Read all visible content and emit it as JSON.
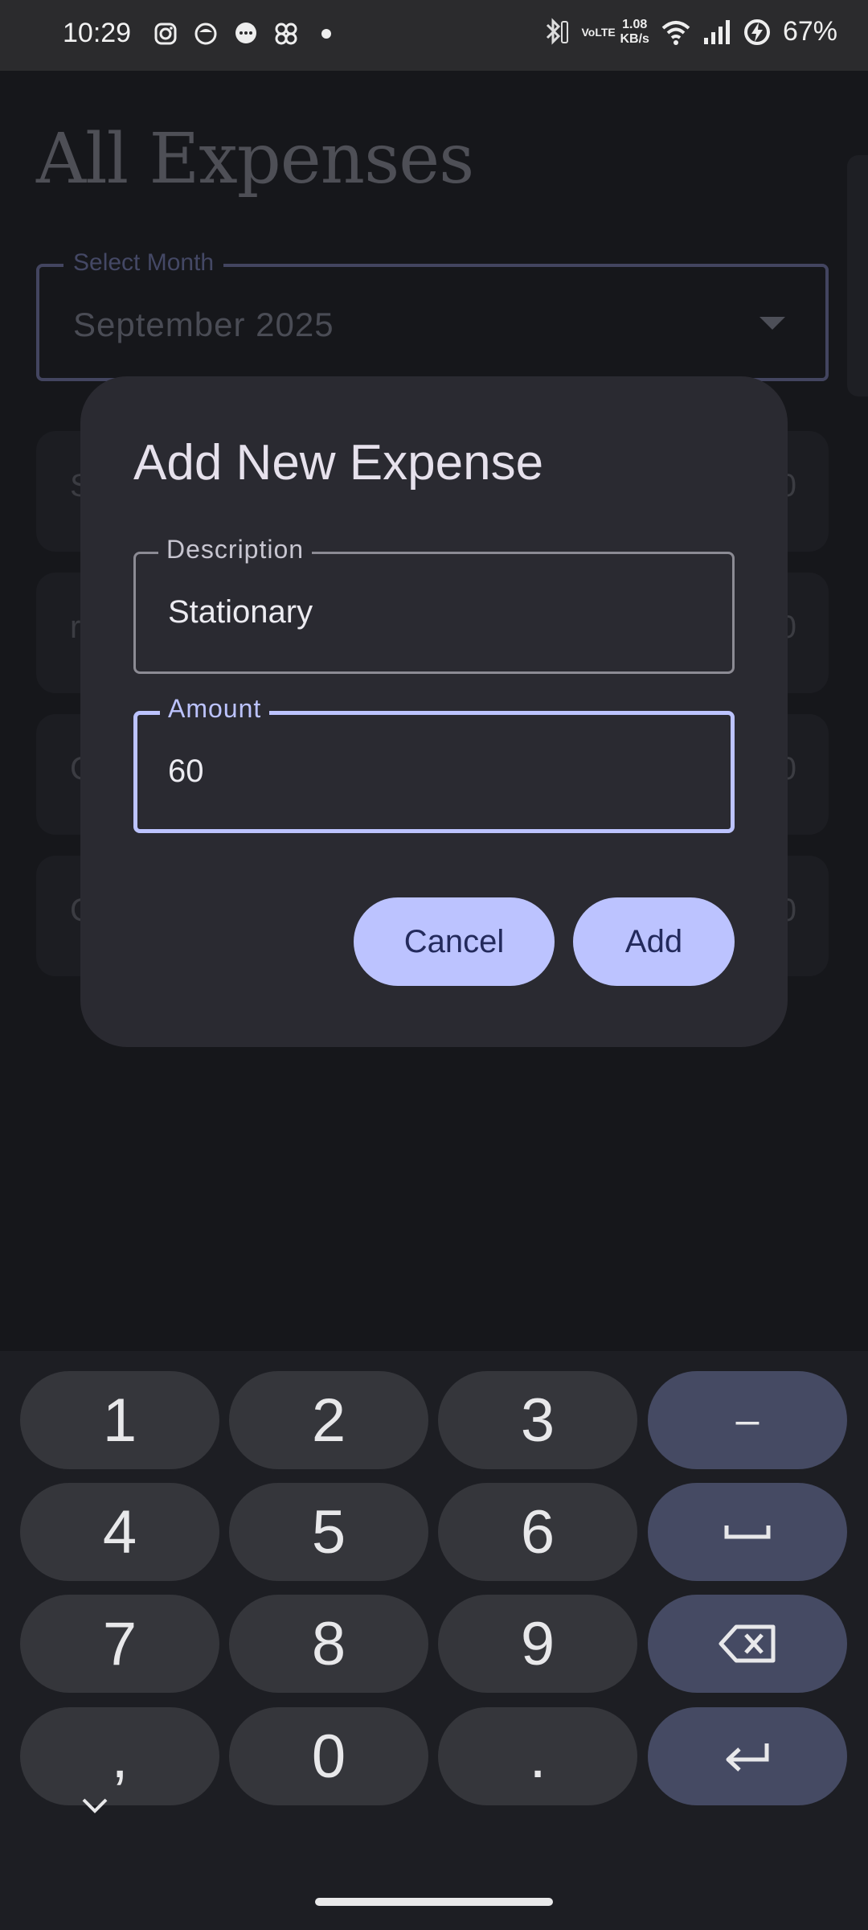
{
  "status_bar": {
    "time": "10:29",
    "net_speed_value": "1.08",
    "net_speed_unit": "KB/s",
    "volte": "VoLTE",
    "battery": "67%",
    "left_icons": [
      "instagram-icon",
      "chat-bubble-icon",
      "messages-icon",
      "pinwheel-icon",
      "dot-icon"
    ]
  },
  "page": {
    "title": "All Expenses",
    "month_select": {
      "label": "Select Month",
      "value": "September 2025"
    },
    "cards": [
      {
        "start": "S",
        "end": "0"
      },
      {
        "start": "r",
        "end": "0"
      },
      {
        "start": "C",
        "end": "0"
      },
      {
        "start": "C",
        "end": "0"
      }
    ]
  },
  "dialog": {
    "title": "Add New Expense",
    "description": {
      "label": "Description",
      "value": "Stationary"
    },
    "amount": {
      "label": "Amount",
      "value": "60"
    },
    "cancel_label": "Cancel",
    "add_label": "Add"
  },
  "keyboard": {
    "rows": [
      [
        "1",
        "2",
        "3",
        "–"
      ],
      [
        "4",
        "5",
        "6",
        "space"
      ],
      [
        "7",
        "8",
        "9",
        "backspace"
      ],
      [
        ",",
        "0",
        ".",
        "enter"
      ]
    ]
  },
  "colors": {
    "accent": "#bcc3ff",
    "dialog_bg": "#2a2a31",
    "keyboard_bg": "#1d1e23",
    "key_bg": "#35363b",
    "function_key_bg": "#454a63"
  }
}
